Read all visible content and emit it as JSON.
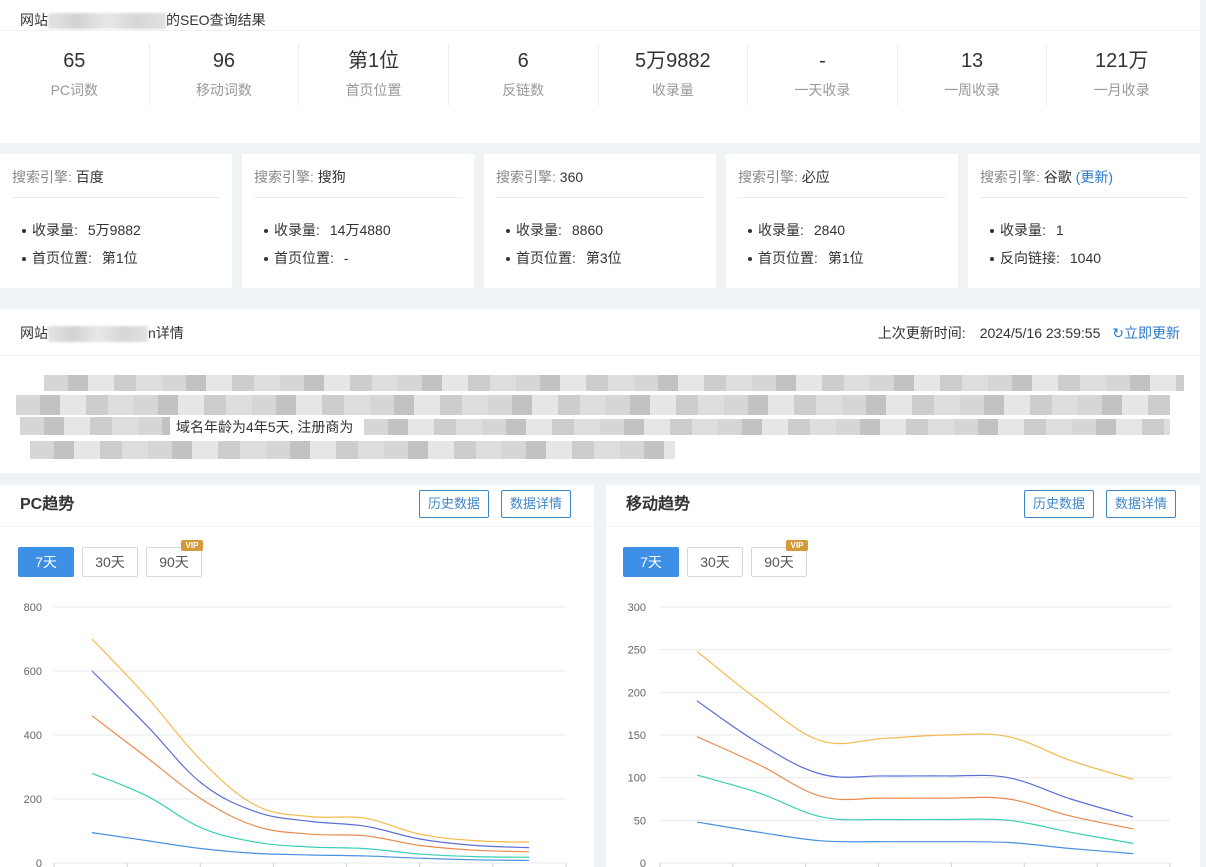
{
  "top": {
    "title_prefix": "网站",
    "title_suffix": "的SEO查询结果",
    "stats": [
      {
        "value": "65",
        "label": "PC词数"
      },
      {
        "value": "96",
        "label": "移动词数"
      },
      {
        "value": "第1位",
        "label": "首页位置"
      },
      {
        "value": "6",
        "label": "反链数"
      },
      {
        "value": "5万9882",
        "label": "收录量"
      },
      {
        "value": "-",
        "label": "一天收录"
      },
      {
        "value": "13",
        "label": "一周收录"
      },
      {
        "value": "121万",
        "label": "一月收录"
      }
    ]
  },
  "engines": [
    {
      "key": "搜索引擎:",
      "name": "百度",
      "rows": [
        {
          "k": "收录量:",
          "v": "5万9882"
        },
        {
          "k": "首页位置:",
          "v": "第1位"
        }
      ]
    },
    {
      "key": "搜索引擎:",
      "name": "搜狗",
      "rows": [
        {
          "k": "收录量:",
          "v": "14万4880"
        },
        {
          "k": "首页位置:",
          "v": "-"
        }
      ]
    },
    {
      "key": "搜索引擎:",
      "name": "360",
      "rows": [
        {
          "k": "收录量:",
          "v": "8860"
        },
        {
          "k": "首页位置:",
          "v": "第3位"
        }
      ]
    },
    {
      "key": "搜索引擎:",
      "name": "必应",
      "rows": [
        {
          "k": "收录量:",
          "v": "2840"
        },
        {
          "k": "首页位置:",
          "v": "第1位"
        }
      ]
    },
    {
      "key": "搜索引擎:",
      "name": "谷歌",
      "update": "(更新)",
      "rows": [
        {
          "k": "收录量:",
          "v": "1"
        },
        {
          "k": "反向链接:",
          "v": "1040"
        }
      ]
    }
  ],
  "detail": {
    "title_prefix": "网站",
    "title_suffix": "n详情",
    "update_label": "上次更新时间:",
    "update_time": "2024/5/16 23:59:55",
    "refresh": "立即更新",
    "text_fragment": "域名年龄为4年5天, 注册商为"
  },
  "pc": {
    "title": "PC趋势",
    "history_btn": "历史数据",
    "detail_btn": "数据详情",
    "periods": [
      "7天",
      "30天",
      "90天"
    ],
    "vip_badge": "VIP"
  },
  "mobile": {
    "title": "移动趋势",
    "history_btn": "历史数据",
    "detail_btn": "数据详情",
    "periods": [
      "7天",
      "30天",
      "90天"
    ],
    "vip_badge": "VIP"
  },
  "chart_data": [
    {
      "type": "line",
      "title": "PC趋势",
      "ylim": [
        0,
        800
      ],
      "yticks": [
        0,
        200,
        400,
        600,
        800
      ],
      "grid": true,
      "series": [
        {
          "color": "#f5b94c",
          "values": [
            700,
            520,
            320,
            180,
            145,
            140,
            90,
            70,
            65
          ]
        },
        {
          "color": "#5b6fd6",
          "values": [
            600,
            430,
            250,
            160,
            130,
            115,
            75,
            55,
            48
          ]
        },
        {
          "color": "#ec8a4c",
          "values": [
            460,
            330,
            200,
            115,
            90,
            85,
            55,
            40,
            35
          ]
        },
        {
          "color": "#3ccfb4",
          "values": [
            280,
            210,
            110,
            65,
            50,
            45,
            28,
            20,
            18
          ]
        },
        {
          "color": "#4a8fe0",
          "values": [
            95,
            70,
            45,
            30,
            25,
            22,
            15,
            10,
            8
          ]
        }
      ]
    },
    {
      "type": "line",
      "title": "移动趋势",
      "ylim": [
        0,
        300
      ],
      "yticks": [
        0,
        50,
        100,
        150,
        200,
        250,
        300
      ],
      "grid": true,
      "series": [
        {
          "color": "#f5b94c",
          "values": [
            248,
            190,
            143,
            146,
            150,
            148,
            120,
            98
          ]
        },
        {
          "color": "#5b6fd6",
          "values": [
            190,
            140,
            104,
            102,
            102,
            100,
            75,
            54
          ]
        },
        {
          "color": "#ec8a4c",
          "values": [
            148,
            115,
            78,
            76,
            76,
            75,
            55,
            40
          ]
        },
        {
          "color": "#3ccfb4",
          "values": [
            103,
            82,
            54,
            51,
            51,
            50,
            36,
            23
          ]
        },
        {
          "color": "#4a8fe0",
          "values": [
            48,
            36,
            26,
            25,
            25,
            24,
            17,
            11
          ]
        }
      ]
    }
  ]
}
